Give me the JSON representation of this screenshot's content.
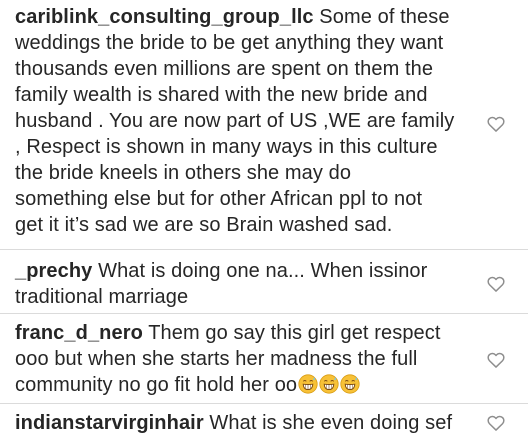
{
  "comments": [
    {
      "username": "cariblink_consulting_group_llc",
      "lines": [
        "Some of these",
        "weddings the bride to be get anything they want",
        "thousands even millions are spent on them the",
        "family wealth is shared with the new bride and",
        "husband . You are now part of US ,WE are family",
        ", Respect is shown in many ways in this culture",
        "the bride kneels in others she may do",
        "something else but for other African ppl to not",
        "get it it’s sad we are so Brain washed sad."
      ]
    },
    {
      "username": "_prechy",
      "lines": [
        "What is doing one na... When issinor",
        "traditional marriage"
      ]
    },
    {
      "username": "franc_d_nero",
      "lines": [
        "Them go say this girl get respect",
        "ooo but when she starts her madness the full",
        "community no go fit hold her oo"
      ],
      "emoji": [
        "grinning-sweat-emoji",
        "grinning-sweat-emoji",
        "grinning-sweat-emoji"
      ]
    },
    {
      "username": "indianstarvirginhair",
      "lines": [
        "What is she even doing sef"
      ]
    }
  ],
  "icons": {
    "like": "heart-outline-icon"
  },
  "colors": {
    "text": "#262626",
    "icon": "#8e8e8e",
    "divider": "#dbdbdb"
  }
}
